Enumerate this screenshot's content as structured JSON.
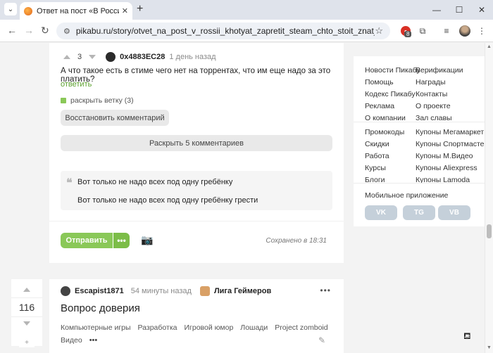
{
  "browser": {
    "tab_title": "Ответ на пост «В России хотят",
    "url": "pikabu.ru/story/otvet_na_post_v_rossii_khotyat_zapretit_steam_chto_stoit_znat_o_novom_zakone_...",
    "extension_badge": "8"
  },
  "comment": {
    "rating": "3",
    "author": "0x4883EC28",
    "time": "1 день назад",
    "text": "А что такое есть в стиме чего нет на торрентах, что им еще надо за это платить?",
    "reply_label": "ответить",
    "expand_branch": "раскрыть ветку (3)",
    "restore_button": "Восстановить комментарий",
    "expand_comments_button": "Раскрыть 5 комментариев",
    "quote_text": "Вот только не надо всех под одну гребёнку",
    "reply_text": "Вот только не надо всех под одну гребёнку грести"
  },
  "submit": {
    "send_label": "Отправить",
    "more_label": "•••",
    "saved_text": "Сохранено в 18:31"
  },
  "post": {
    "rating": "116",
    "author": "Escapist1871",
    "time": "54 минуты назад",
    "community": "Лига Геймеров",
    "title": "Вопрос доверия",
    "tags": [
      "Компьютерные игры",
      "Разработка",
      "Игровой юмор",
      "Лошади",
      "Project zomboid"
    ],
    "tags_row2": "Видео",
    "more_tags": "•••",
    "add_label": "+"
  },
  "sidebar": {
    "links_col1": [
      "Новости Пикабу",
      "Помощь",
      "Кодекс Пикабу",
      "Реклама",
      "О компании"
    ],
    "links_col2": [
      "Верификации",
      "Награды",
      "Контакты",
      "О проекте",
      "Зал славы"
    ],
    "promo_col1": [
      "Промокоды",
      "Скидки",
      "Работа",
      "Курсы",
      "Блоги"
    ],
    "promo_col2": [
      "Купоны Мегамаркет",
      "Купоны Спортмастер",
      "Купоны М.Видео",
      "Купоны Aliexpress",
      "Купоны Lamoda"
    ],
    "mobile_app_label": "Мобильное приложение",
    "app_buttons": [
      "VK",
      "TG",
      "VB"
    ]
  },
  "colors": {
    "accent_green": "#8ac858",
    "link_green": "#5aa02c",
    "app_button": "#c5d0da"
  }
}
